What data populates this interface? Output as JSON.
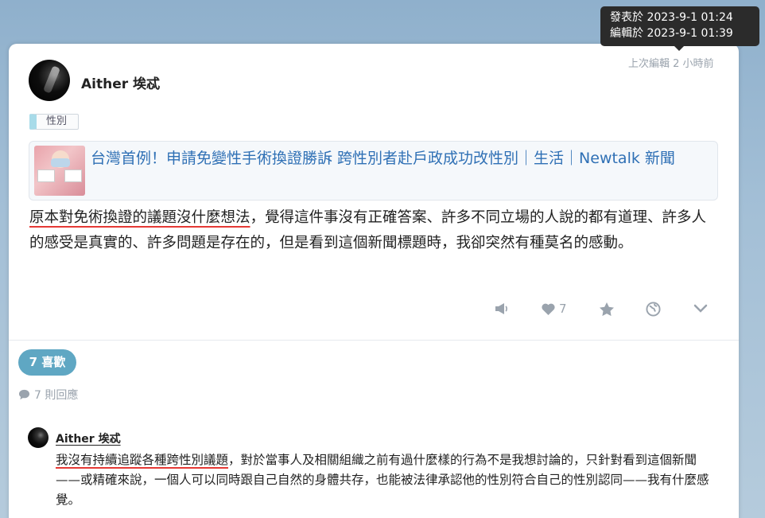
{
  "tooltip": {
    "posted": "發表於 2023-9-1 01:24",
    "edited": "編輯於 2023-9-1 01:39"
  },
  "post": {
    "last_edit": "上次編輯 2 小時前",
    "author": "Aither 埃忒",
    "tag": "性別",
    "link_title": "台灣首例！申請免變性手術換證勝訴 跨性別者赴戶政成功改性別｜生活｜Newtalk 新聞",
    "body_underlined": "原本對免術換證的議題沒什麼想法",
    "body_rest": "，覺得這件事沒有正確答案、許多不同立場的人說的都有道理、許多人的感受是真實的、許多問題是存在的，但是看到這個新聞標題時，我卻突然有種莫名的感動。",
    "like_count": "7"
  },
  "summary": {
    "likes_label": "7 喜歡",
    "replies_label": "7 則回應"
  },
  "reply": {
    "author": "Aither 埃忒",
    "text_underlined": "我沒有持續追蹤各種跨性別議題",
    "text_rest": "，對於當事人及相關組織之前有過什麼樣的行為不是我想討論的，只針對看到這個新聞——或精確來說，一個人可以同時跟自己自然的身體共存，也能被法律承認他的性別符合自己的性別認同——我有什麼感覺。"
  },
  "colors": {
    "link": "#2f70b5",
    "accent_badge": "#5fa7c3",
    "underline": "#e53935",
    "muted": "#9aa3ad"
  }
}
